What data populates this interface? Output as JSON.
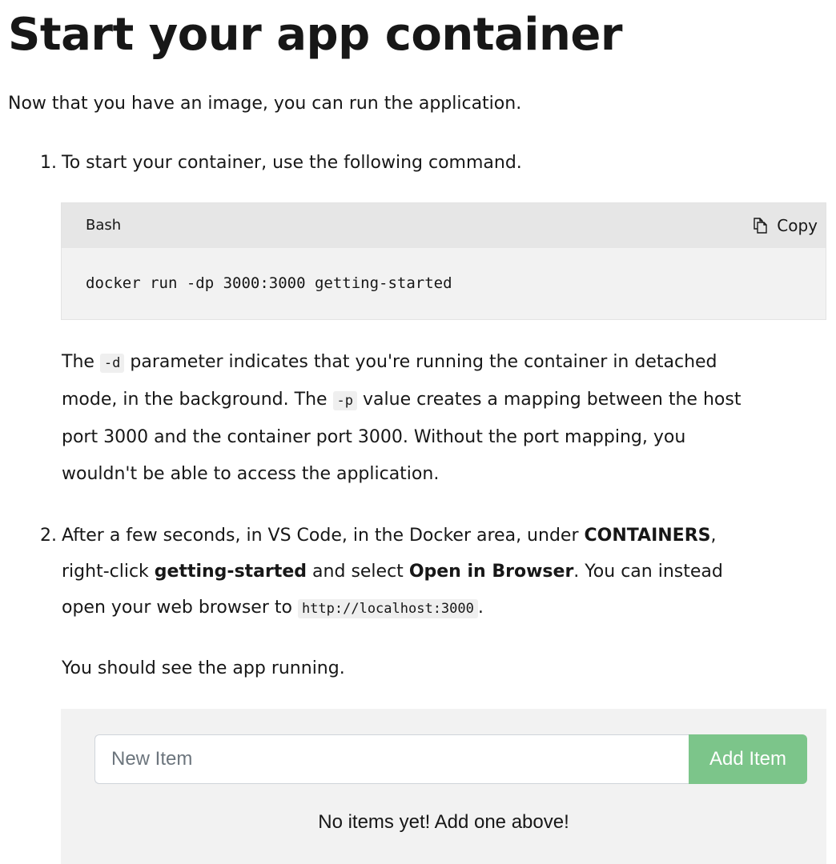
{
  "article": {
    "title": "Start your app container",
    "intro": "Now that you have an image, you can run the application."
  },
  "steps": [
    {
      "number": "1.",
      "text": "To start your container, use the following command.",
      "code_block": {
        "language": "Bash",
        "copy_label": "Copy",
        "code": "docker run -dp 3000:3000 getting-started"
      },
      "explanation": {
        "t1": "The ",
        "c1": "-d",
        "t2": " parameter indicates that you're running the container in detached",
        "t3": "mode, in the background. The ",
        "c2": "-p",
        "t4": " value creates a mapping between the host",
        "t5": "port 3000 and the container port 3000. Without the port mapping, you",
        "t6": "wouldn't be able to access the application."
      }
    },
    {
      "number": "2.",
      "text": {
        "t1": "After a few seconds, in VS Code, in the Docker area, under ",
        "b1": "CONTAINERS",
        "t2": ",",
        "t3": "right-click ",
        "b2": "getting-started",
        "t4": " and select ",
        "b3": "Open in Browser",
        "t5": ". You can instead",
        "t6": "open your web browser to ",
        "c1": "http://localhost:3000",
        "t7": "."
      },
      "result": "You should see the app running."
    }
  ],
  "app_preview": {
    "input_placeholder": "New Item",
    "add_button_label": "Add Item",
    "empty_message": "No items yet! Add one above!"
  },
  "colors": {
    "code_header_bg": "#e6e6e6",
    "code_bg": "#f2f2f2",
    "add_button_bg": "#7cc58a"
  },
  "icons": {
    "copy": "copy-icon"
  }
}
